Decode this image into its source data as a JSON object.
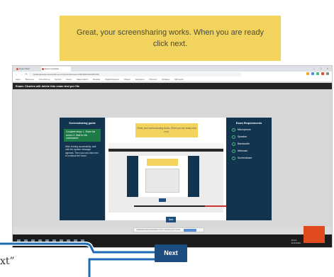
{
  "banner": {
    "text": "Great, your screensharing works. When you are ready click next."
  },
  "browser": {
    "tabs": [
      "Exam Start",
      "Exam Interface"
    ],
    "window_controls": "–  □  ×",
    "address": "mobiledevelopmentsolutions.com/exam/browser/ABCDEF0123456789",
    "bookmarks": [
      "Apps",
      "Business",
      "Cloud Drive",
      "Sprints",
      "News",
      "Sales Admin",
      "Booklet",
      "Digital Reports",
      "Videos",
      "Hangouts",
      "Pictures",
      "Updates",
      "Microsoft"
    ]
  },
  "notice": {
    "text": "Exam: Charles will delete this exam test per file"
  },
  "left_panel": {
    "title": "Screensharing guide",
    "step": "Complete steps: 1. Share the screen 2. Wait for the confirmation",
    "body": "After sharing successfully, wait until the system message appears. Then you can click next to continue the exam."
  },
  "right_panel": {
    "title": "Exam Requirements",
    "items": [
      "Microphone",
      "Speaker",
      "Bandwidth",
      "Webcam",
      "Screenshare"
    ]
  },
  "mini_banner": {
    "text": "Great, your screensharing works. When you are ready click next."
  },
  "small_next": "Next",
  "toast": {
    "text": "mobiledevelopmentsolutions.com is sharing your screen."
  },
  "clock": {
    "time": "10:24",
    "date": "2/14/2020"
  },
  "next_button": "Next",
  "quote_fragment": "xt”",
  "colors": {
    "banner": "#f2d35e",
    "navy": "#13344f",
    "button": "#1d4d7e",
    "connector": "#1f69b5",
    "taskbar_accent": "#e04a1f"
  }
}
